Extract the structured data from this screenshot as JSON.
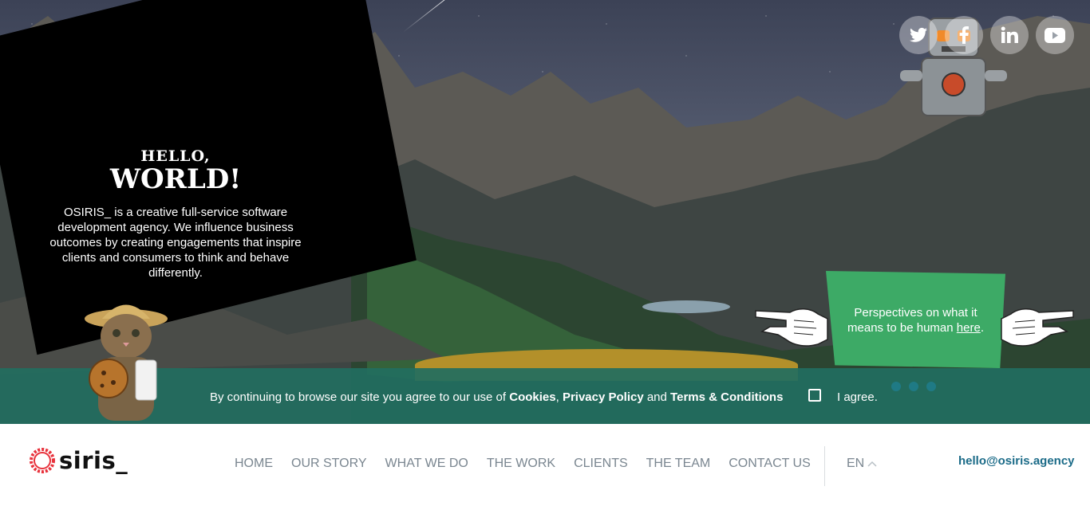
{
  "hero": {
    "hello_small": "HELLO,",
    "hello_big": "WORLD!",
    "description": "OSIRIS_ is a creative full-service software development agency. We influence business outcomes by creating engagements that inspire clients and consumers to think and behave differently."
  },
  "social": {
    "icons": [
      "twitter-icon",
      "facebook-icon",
      "linkedin-icon",
      "youtube-icon"
    ]
  },
  "perspectives": {
    "text": "Perspectives on what it means to be human ",
    "link_label": "here",
    "suffix": "."
  },
  "cookie": {
    "prefix": "By continuing to browse our site you agree to our use of ",
    "cookies": "Cookies",
    "comma": ", ",
    "privacy": "Privacy Policy",
    "and": " and ",
    "terms": "Terms & Conditions",
    "agree_label": "I agree.",
    "agreed": false
  },
  "brand": {
    "logo_text": "siris_",
    "accent_color": "#e8323c",
    "cookie_bar_color": "#226e60",
    "green_card_color": "#3daa66"
  },
  "nav": {
    "items": [
      "HOME",
      "OUR STORY",
      "WHAT WE DO",
      "THE WORK",
      "CLIENTS",
      "THE TEAM",
      "CONTACT US"
    ],
    "language": "EN",
    "email": "hello@osiris.agency"
  }
}
